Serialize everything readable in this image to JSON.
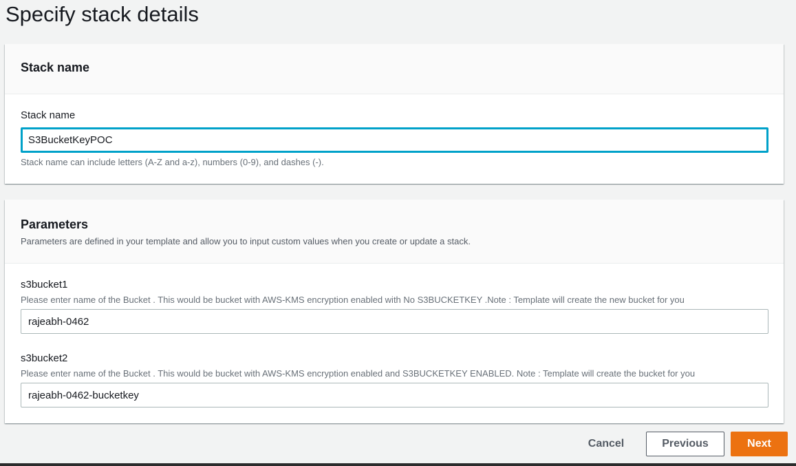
{
  "page": {
    "title": "Specify stack details"
  },
  "stack_name_panel": {
    "title": "Stack name",
    "field_label": "Stack name",
    "value": "S3BucketKeyPOC",
    "hint": "Stack name can include letters (A-Z and a-z), numbers (0-9), and dashes (-)."
  },
  "parameters_panel": {
    "title": "Parameters",
    "description": "Parameters are defined in your template and allow you to input custom values when you create or update a stack.",
    "params": [
      {
        "label": "s3bucket1",
        "description": "Please enter name of the Bucket . This would be bucket with AWS-KMS encryption enabled with No S3BUCKETKEY .Note : Template will create the new bucket for you",
        "value": "rajeabh-0462"
      },
      {
        "label": "s3bucket2",
        "description": "Please enter name of the Bucket . This would be bucket with AWS-KMS encryption enabled and S3BUCKETKEY ENABLED. Note : Template will create the bucket for you",
        "value": "rajeabh-0462-bucketkey"
      }
    ]
  },
  "footer": {
    "cancel_label": "Cancel",
    "previous_label": "Previous",
    "next_label": "Next"
  },
  "colors": {
    "primary_button": "#ec7211",
    "focus_ring": "#00a1c9",
    "page_background": "#f2f3f3"
  }
}
